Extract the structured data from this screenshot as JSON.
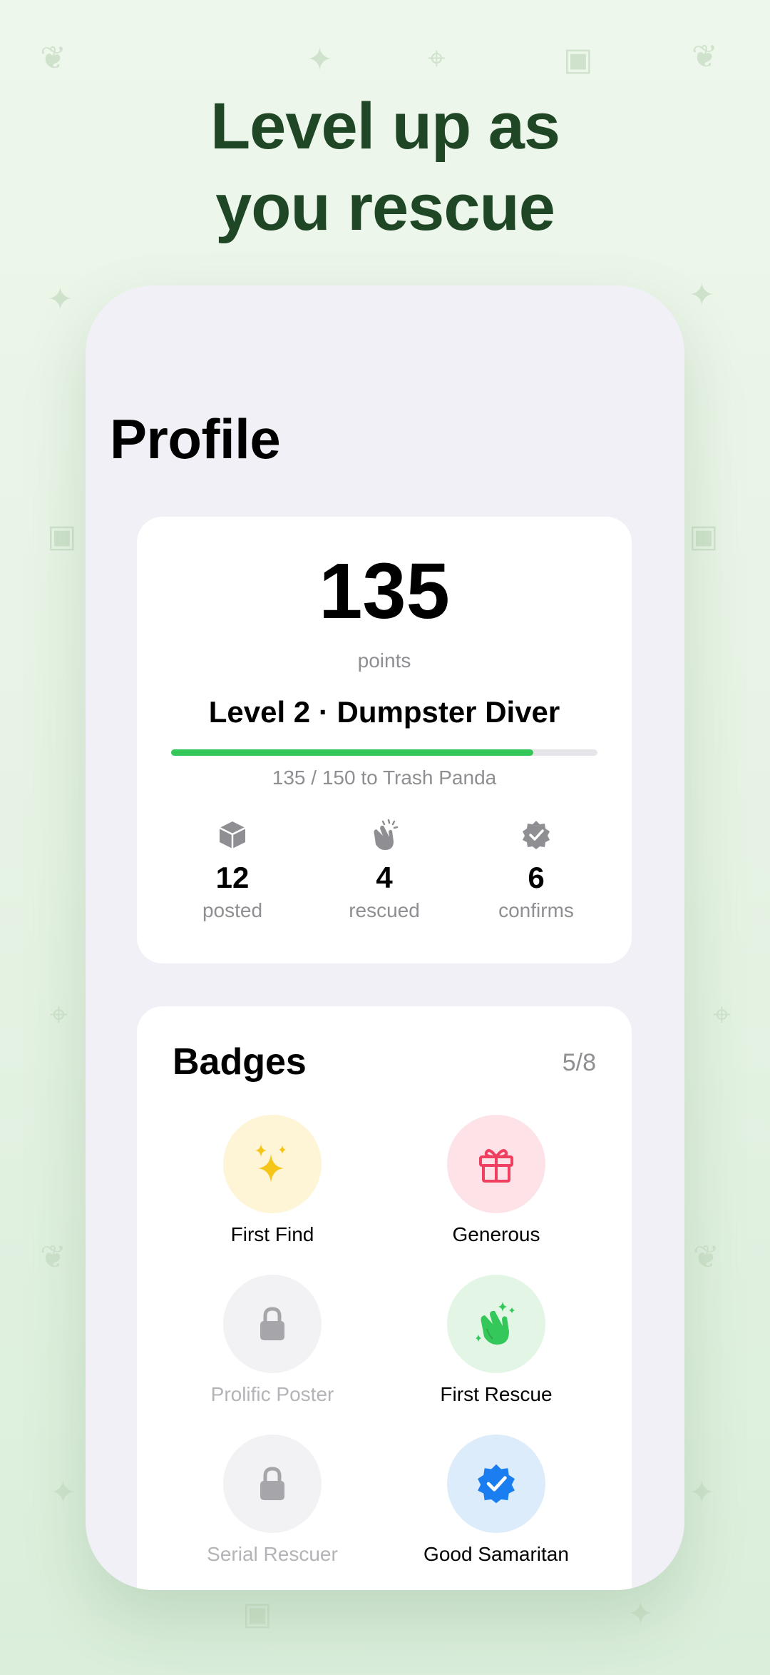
{
  "headline": {
    "line1": "Level up as",
    "line2": "you rescue"
  },
  "profile": {
    "title": "Profile",
    "points": "135",
    "points_label": "points",
    "level": "Level 2 · Dumpster Diver",
    "progress_fraction": 0.85,
    "progress_caption": "135 / 150 to Trash Panda",
    "accent_color": "#34c759",
    "stats": [
      {
        "icon": "box-icon",
        "value": "12",
        "label": "posted"
      },
      {
        "icon": "clapping-hands-icon",
        "value": "4",
        "label": "rescued"
      },
      {
        "icon": "verified-badge-icon",
        "value": "6",
        "label": "confirms"
      }
    ]
  },
  "badges": {
    "title": "Badges",
    "count": "5/8",
    "items": [
      {
        "name": "First Find",
        "icon": "sparkles-icon",
        "locked": false,
        "bg": "#fdf5d6"
      },
      {
        "name": "Generous",
        "icon": "gift-icon",
        "locked": false,
        "bg": "#fde3e8"
      },
      {
        "name": "Prolific Poster",
        "icon": "lock-icon",
        "locked": true,
        "bg": "#f2f2f4"
      },
      {
        "name": "First Rescue",
        "icon": "clapping-hands-icon",
        "locked": false,
        "bg": "#e3f6e6"
      },
      {
        "name": "Serial Rescuer",
        "icon": "lock-icon",
        "locked": true,
        "bg": "#f2f2f4"
      },
      {
        "name": "Good Samaritan",
        "icon": "verified-badge-icon",
        "locked": false,
        "bg": "#dcecfb"
      }
    ]
  }
}
